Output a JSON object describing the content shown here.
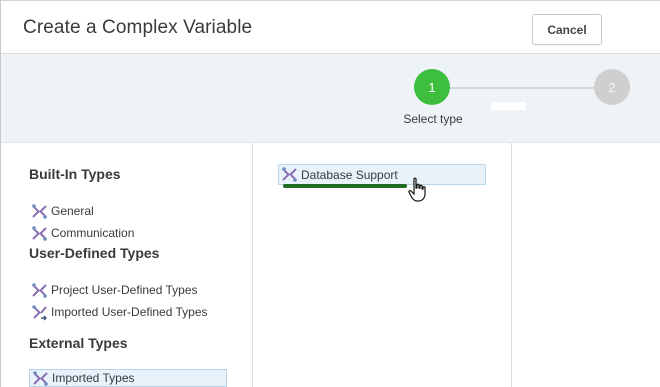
{
  "dialog": {
    "title": "Create a Complex Variable",
    "cancel_label": "Cancel"
  },
  "stepper": {
    "steps": [
      {
        "number": "1",
        "label": "Select type",
        "state": "active",
        "color": "#3dbe3d"
      },
      {
        "number": "2",
        "label": "",
        "state": "inactive",
        "color": "#cfcfcf"
      }
    ]
  },
  "left_panel": {
    "sections": [
      {
        "title": "Built-In Types",
        "items": [
          {
            "label": "General",
            "icon": "complex-type-icon"
          },
          {
            "label": "Communication",
            "icon": "complex-type-icon"
          }
        ]
      },
      {
        "title": "User-Defined Types",
        "items": [
          {
            "label": "Project User-Defined Types",
            "icon": "complex-type-icon"
          },
          {
            "label": "Imported User-Defined Types",
            "icon": "imported-type-icon"
          }
        ]
      },
      {
        "title": "External Types",
        "items": [
          {
            "label": "Imported Types",
            "icon": "complex-type-icon",
            "selected": true
          }
        ]
      }
    ]
  },
  "middle_panel": {
    "items": [
      {
        "label": "Database Support",
        "icon": "complex-type-icon",
        "selected": true
      }
    ]
  },
  "colors": {
    "accent_green": "#3dbe3d",
    "selection_bg": "#e8f2fa",
    "underline": "#1f6b22"
  }
}
